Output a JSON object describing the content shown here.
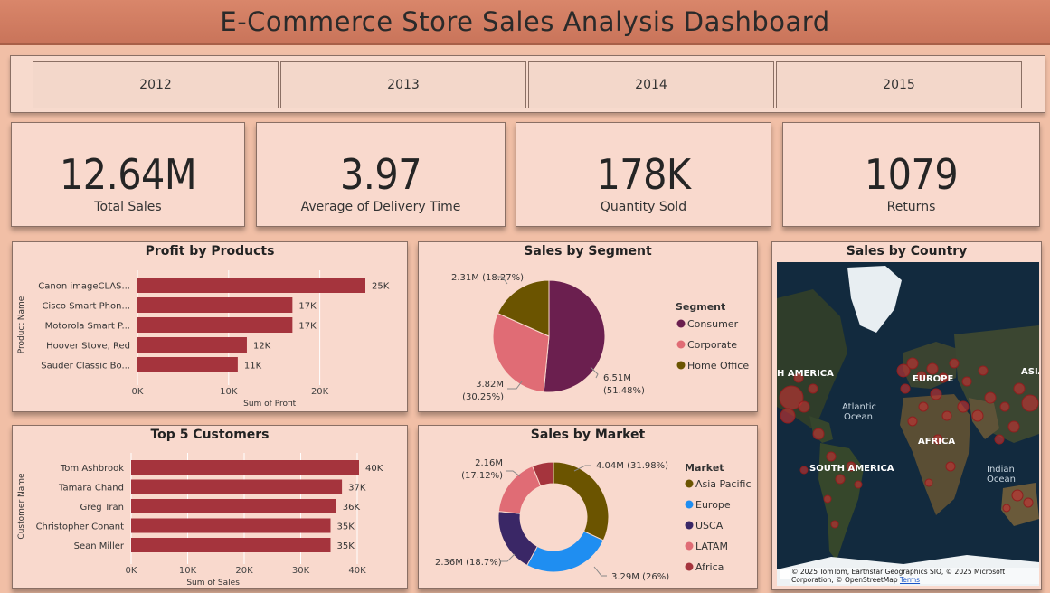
{
  "header": {
    "title": "E-Commerce Store Sales Analysis Dashboard"
  },
  "years": [
    "2012",
    "2013",
    "2014",
    "2015"
  ],
  "kpis": [
    {
      "value": "12.64M",
      "label": "Total Sales"
    },
    {
      "value": "3.97",
      "label": "Average of Delivery Time"
    },
    {
      "value": "178K",
      "label": "Quantity Sold"
    },
    {
      "value": "1079",
      "label": "Returns"
    }
  ],
  "colors": {
    "bar": "#a5343d",
    "consumer": "#6b1f4f",
    "corporate": "#e06c75",
    "home_office": "#6b5400",
    "asia_pacific": "#6b5400",
    "europe": "#1f8ef1",
    "usca": "#3a2766",
    "latam": "#e06c75",
    "africa": "#a5343d"
  },
  "chart_data": [
    {
      "type": "bar",
      "orientation": "horizontal",
      "title": "Profit by Products",
      "xlabel": "Sum of Profit",
      "ylabel": "Product Name",
      "categories": [
        "Canon imageCLAS...",
        "Cisco Smart Phon...",
        "Motorola Smart P...",
        "Hoover Stove, Red",
        "Sauder Classic Bo..."
      ],
      "values": [
        25000,
        17000,
        17000,
        12000,
        11000
      ],
      "data_labels": [
        "25K",
        "17K",
        "17K",
        "12K",
        "11K"
      ],
      "xticks": [
        "0K",
        "10K",
        "20K"
      ],
      "xlim": [
        0,
        25000
      ],
      "grid": true
    },
    {
      "type": "pie",
      "title": "Sales by Segment",
      "legend_title": "Segment",
      "legend_position": "right",
      "categories": [
        "Consumer",
        "Corporate",
        "Home Office"
      ],
      "values": [
        6.51,
        3.82,
        2.31
      ],
      "percentages": [
        51.48,
        30.25,
        18.27
      ],
      "data_labels": [
        "6.51M",
        "(51.48%)",
        "3.82M",
        "(30.25%)",
        "2.31M (18.27%)"
      ]
    },
    {
      "type": "bar",
      "orientation": "horizontal",
      "title": "Top 5 Customers",
      "xlabel": "Sum of Sales",
      "ylabel": "Customer Name",
      "categories": [
        "Tom Ashbrook",
        "Tamara Chand",
        "Greg Tran",
        "Christopher Conant",
        "Sean Miller"
      ],
      "values": [
        40000,
        37000,
        36000,
        35000,
        35000
      ],
      "data_labels": [
        "40K",
        "37K",
        "36K",
        "35K",
        "35K"
      ],
      "xticks": [
        "0K",
        "10K",
        "20K",
        "30K",
        "40K"
      ],
      "xlim": [
        0,
        40000
      ],
      "grid": true
    },
    {
      "type": "pie",
      "variant": "donut",
      "title": "Sales by Market",
      "legend_title": "Market",
      "legend_position": "right",
      "categories": [
        "Asia Pacific",
        "Europe",
        "USCA",
        "LATAM",
        "Africa"
      ],
      "values": [
        4.04,
        3.29,
        2.36,
        2.16,
        0.79
      ],
      "percentages": [
        31.98,
        26.0,
        18.7,
        17.12,
        6.2
      ],
      "data_labels": [
        "4.04M (31.98%)",
        "3.29M (26%)",
        "2.36M (18.7%)",
        "2.16M",
        "(17.12%)"
      ]
    }
  ],
  "map": {
    "title": "Sales by Country",
    "labels": [
      "H AMERICA",
      "EUROPE",
      "ASIA",
      "Atlantic",
      "Ocean",
      "AFRICA",
      "SOUTH AMERICA",
      "Indian",
      "Ocean"
    ],
    "attribution": "© 2025 TomTom, Earthstar Geographics SIO, © 2025 Microsoft Corporation, © OpenStreetMap",
    "terms": "Terms"
  }
}
